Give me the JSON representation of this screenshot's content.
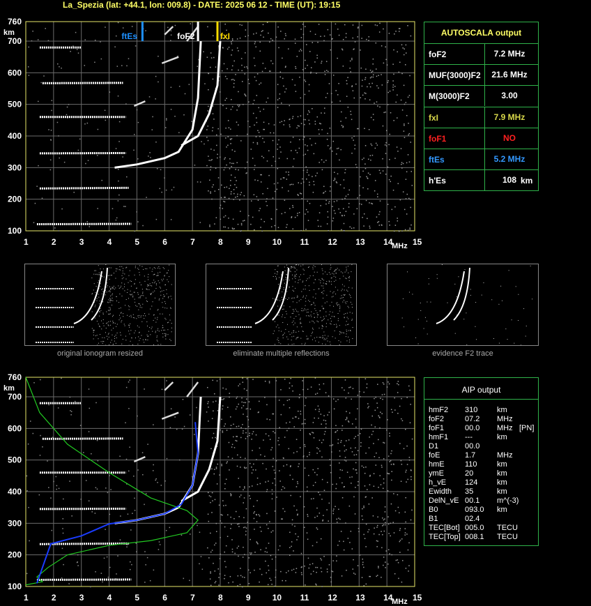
{
  "header": "La_Spezia (lat: +44.1, lon: 009.8) - DATE: 2025 06 12 - TIME (UT): 19:15",
  "axis": {
    "y_ticks": [
      "760",
      "700",
      "600",
      "500",
      "400",
      "300",
      "200",
      "100"
    ],
    "y_unit": "km",
    "x_ticks": [
      "1",
      "2",
      "3",
      "4",
      "5",
      "6",
      "7",
      "8",
      "9",
      "10",
      "11",
      "12",
      "13",
      "14",
      "15"
    ],
    "x_unit": "MHz"
  },
  "markers": [
    {
      "label": "ftEs",
      "freq": 5.2,
      "color": "#1e90ff"
    },
    {
      "label": "foF2",
      "freq": 7.2,
      "color": "#ffffff"
    },
    {
      "label": "fxI",
      "freq": 7.9,
      "color": "#ffdd00"
    }
  ],
  "autoscala": {
    "title": "AUTOSCALA output",
    "rows": [
      {
        "key": "foF2",
        "value": "7.2 MHz",
        "color": "#ffffff"
      },
      {
        "key": "MUF(3000)F2",
        "value": "21.6 MHz",
        "color": "#ffffff"
      },
      {
        "key": "M(3000)F2",
        "value": "3.00",
        "color": "#ffffff"
      },
      {
        "key": "fxI",
        "value": "7.9 MHz",
        "color": "#d8d84a"
      },
      {
        "key": "foF1",
        "value": "NO",
        "color": "#ff2020"
      },
      {
        "key": "ftEs",
        "value": "5.2 MHz",
        "color": "#3399ff"
      },
      {
        "key": "h'Es",
        "value": "108",
        "unit": "km",
        "color": "#ffffff"
      }
    ]
  },
  "thumbs": [
    {
      "caption": "original ionogram resized"
    },
    {
      "caption": "eliminate multiple reflections"
    },
    {
      "caption": "evidence F2 trace"
    }
  ],
  "aip": {
    "title": "AIP output",
    "rows": [
      [
        "hmF2",
        "310",
        "km",
        ""
      ],
      [
        "foF2",
        "07.2",
        "MHz",
        ""
      ],
      [
        "foF1",
        "00.0",
        "MHz",
        "[PN]"
      ],
      [
        "hmF1",
        "---",
        "km",
        ""
      ],
      [
        "D1",
        "00.0",
        "",
        ""
      ],
      [
        "foE",
        "1.7",
        "MHz",
        ""
      ],
      [
        "hmE",
        "110",
        "km",
        ""
      ],
      [
        "ymE",
        "20",
        "km",
        ""
      ],
      [
        "h_vE",
        "124",
        "km",
        ""
      ],
      [
        "Ewidth",
        "35",
        "km",
        ""
      ],
      [
        "DelN_vE",
        "00.1",
        "m^(-3)",
        ""
      ],
      [
        "B0",
        "093.0",
        "km",
        ""
      ],
      [
        "B1",
        "02.4",
        "",
        ""
      ],
      [
        "TEC[Bot]",
        "005.0",
        "TECU",
        ""
      ],
      [
        "TEC[Top]",
        "008.1",
        "TECU",
        ""
      ]
    ]
  },
  "chart_data": [
    {
      "type": "scatter",
      "xlim": [
        1,
        15
      ],
      "ylim": [
        100,
        760
      ],
      "traces": [
        {
          "name": "Es",
          "points": [
            [
              1.4,
              121
            ],
            [
              2,
              121
            ],
            [
              3,
              121
            ],
            [
              4,
              121
            ],
            [
              4.8,
              122
            ]
          ]
        },
        {
          "name": "Es2",
          "points": [
            [
              1.5,
              234
            ],
            [
              2.5,
              234
            ],
            [
              3.5,
              235
            ],
            [
              4.7,
              236
            ]
          ]
        },
        {
          "name": "F2",
          "points": [
            [
              4.2,
              300
            ],
            [
              5,
              310
            ],
            [
              6,
              330
            ],
            [
              6.5,
              350
            ],
            [
              7,
              420
            ],
            [
              7.2,
              520
            ],
            [
              7.3,
              700
            ]
          ]
        },
        {
          "name": "F2x",
          "points": [
            [
              6.6,
              370
            ],
            [
              7.2,
              400
            ],
            [
              7.6,
              470
            ],
            [
              7.9,
              560
            ],
            [
              8,
              700
            ]
          ]
        }
      ]
    },
    {
      "type": "line",
      "xlim": [
        1,
        15
      ],
      "ylim": [
        100,
        760
      ],
      "series": [
        {
          "points": [
            [
              1,
              760
            ],
            [
              1.5,
              650
            ],
            [
              2.5,
              550
            ],
            [
              4,
              460
            ],
            [
              5.5,
              380
            ],
            [
              6.8,
              340
            ],
            [
              7.2,
              310
            ],
            [
              6.8,
              270
            ],
            [
              5.5,
              245
            ],
            [
              4,
              230
            ],
            [
              2.5,
              200
            ],
            [
              1.8,
              160
            ],
            [
              1.4,
              130
            ],
            [
              1.6,
              115
            ],
            [
              1,
              105
            ]
          ]
        },
        {
          "points": [
            [
              1.4,
              110
            ],
            [
              1.9,
              235
            ],
            [
              3,
              260
            ],
            [
              4,
              298
            ],
            [
              5,
              310
            ],
            [
              6,
              330
            ],
            [
              6.6,
              360
            ],
            [
              7,
              420
            ],
            [
              7.2,
              520
            ],
            [
              7.1,
              620
            ]
          ]
        }
      ]
    }
  ]
}
